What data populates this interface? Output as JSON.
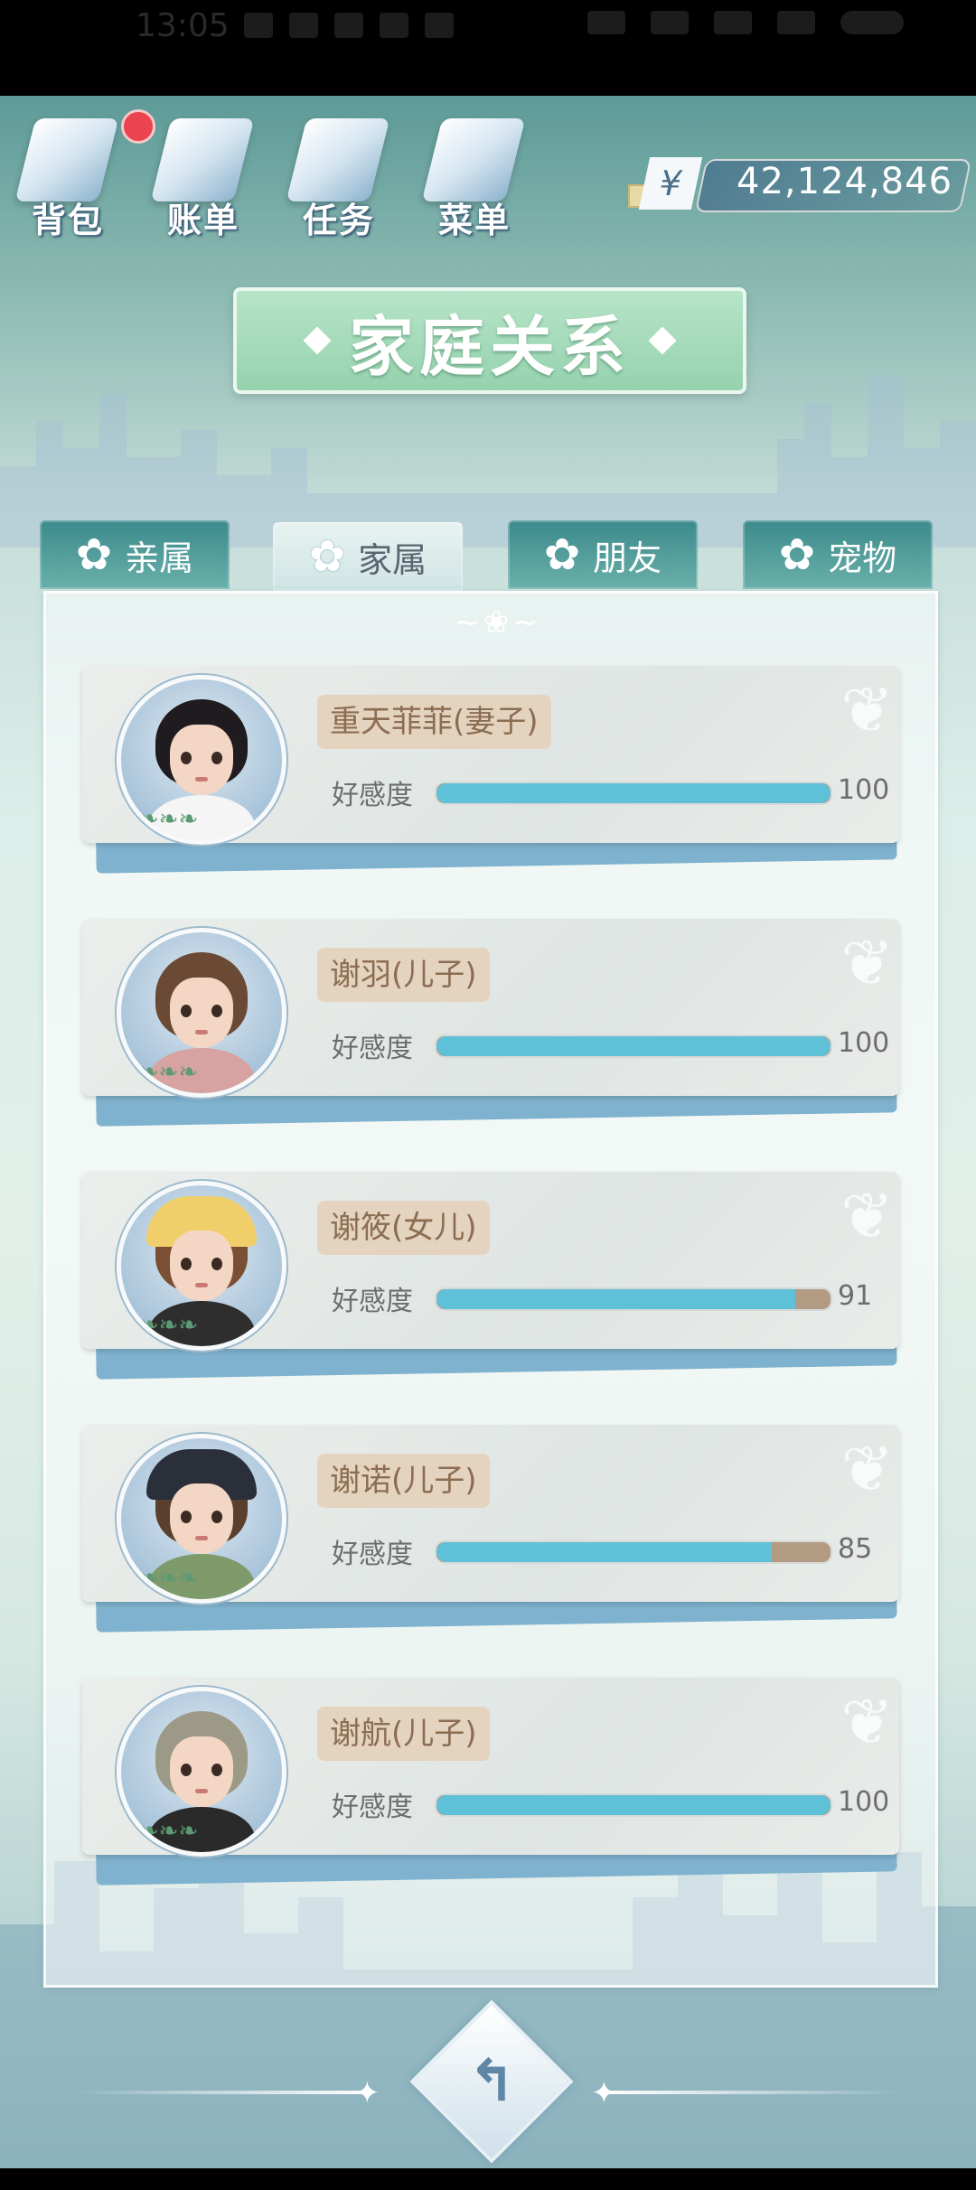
{
  "status_bar": {
    "time": "13:05"
  },
  "top_menu": [
    {
      "label": "背包",
      "icon": "backpack-icon",
      "has_notification": true
    },
    {
      "label": "账单",
      "icon": "bill-icon"
    },
    {
      "label": "任务",
      "icon": "task-icon"
    },
    {
      "label": "菜单",
      "icon": "menu-icon"
    }
  ],
  "money": {
    "symbol": "¥",
    "amount": "42,124,846"
  },
  "title": "家庭关系",
  "tabs": [
    {
      "label": "亲属",
      "active": false
    },
    {
      "label": "家属",
      "active": true
    },
    {
      "label": "朋友",
      "active": false
    },
    {
      "label": "宠物",
      "active": false
    }
  ],
  "affinity_label": "好感度",
  "members": [
    {
      "name": "重天菲菲(妻子)",
      "affinity": 100,
      "affinity_text": "100"
    },
    {
      "name": "谢羽(儿子)",
      "affinity": 100,
      "affinity_text": "100"
    },
    {
      "name": "谢筱(女儿)",
      "affinity": 91,
      "affinity_text": "91"
    },
    {
      "name": "谢诺(儿子)",
      "affinity": 85,
      "affinity_text": "85"
    },
    {
      "name": "谢航(儿子)",
      "affinity": 100,
      "affinity_text": "100"
    }
  ],
  "colors": {
    "bar_fill": "#5ec1d8",
    "bar_track": "#b39a83",
    "title_green": "#95d2ad"
  }
}
